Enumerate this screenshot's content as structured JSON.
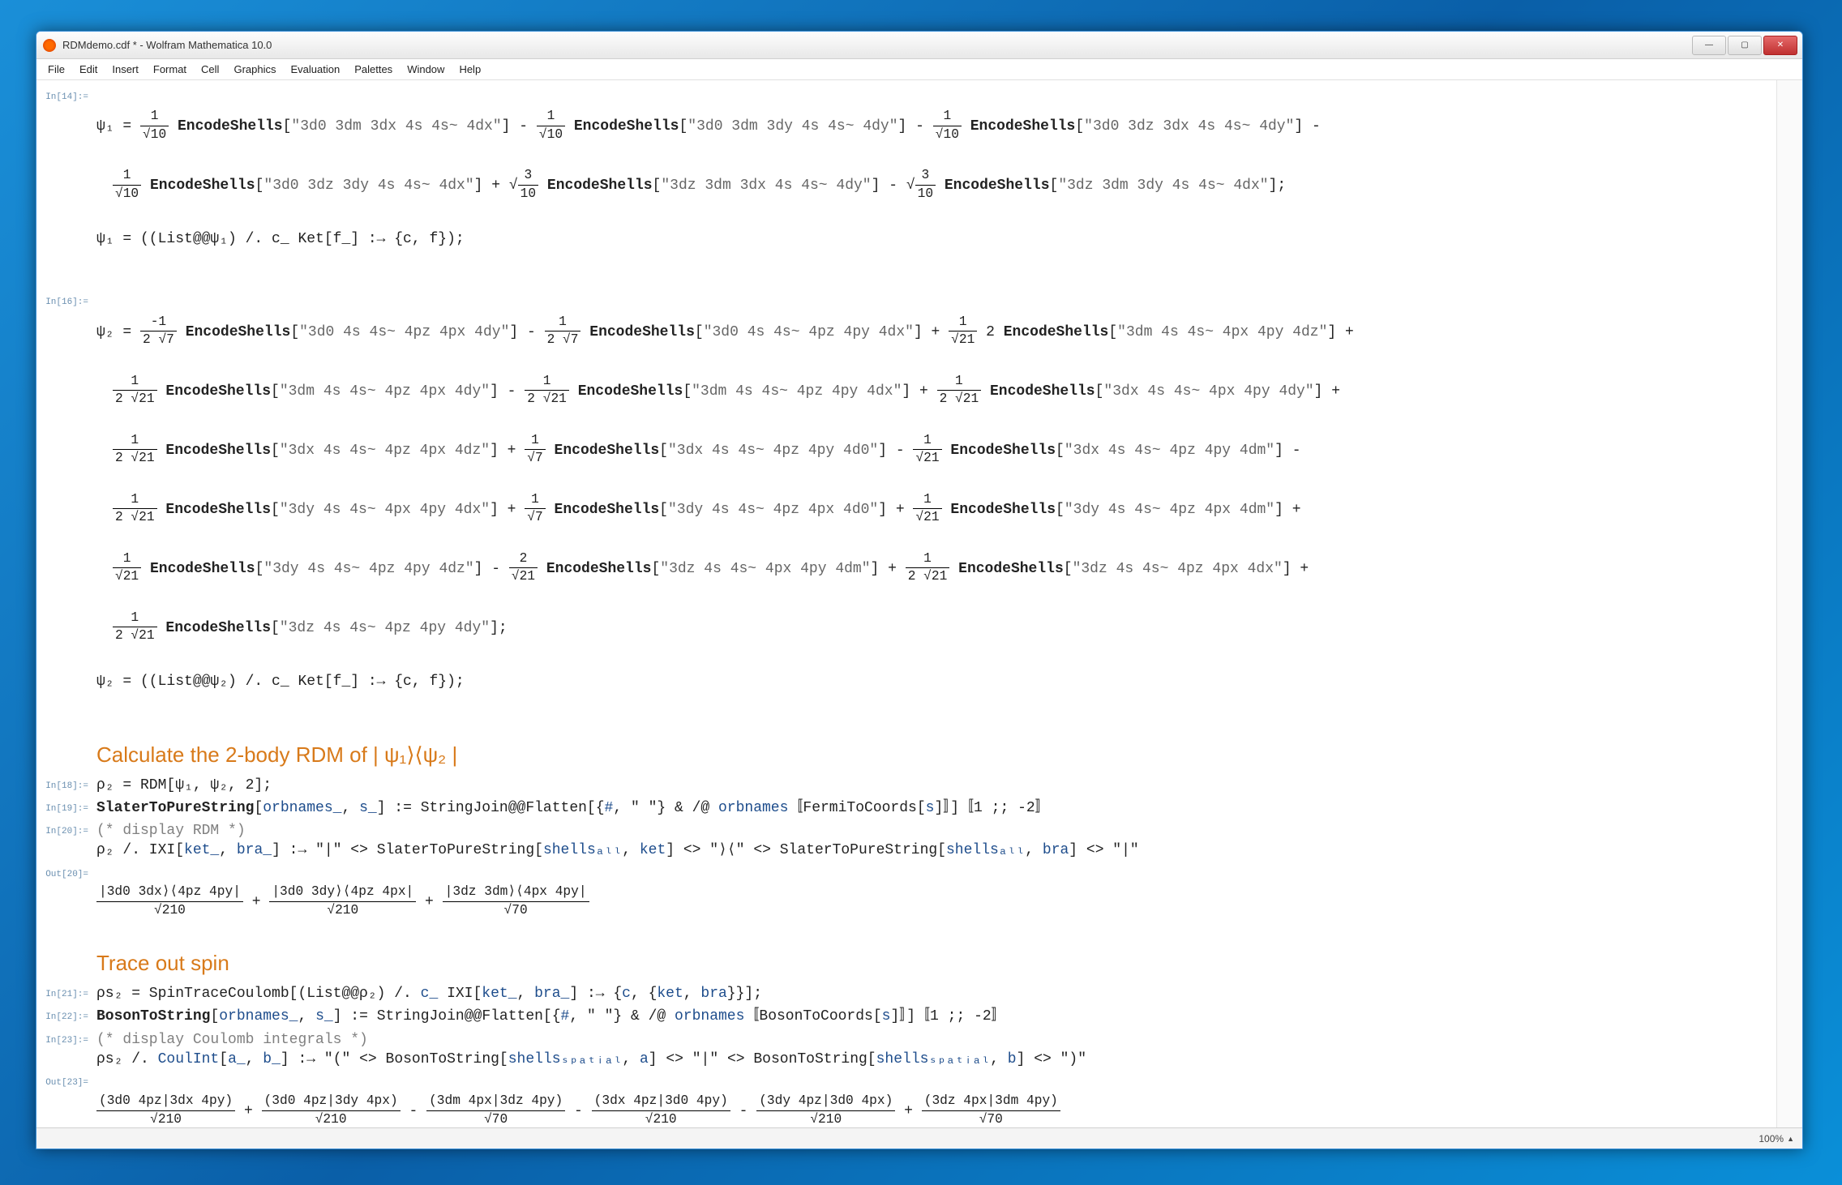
{
  "window": {
    "title": "RDMdemo.cdf * - Wolfram Mathematica 10.0"
  },
  "menu": {
    "file": "File",
    "edit": "Edit",
    "insert": "Insert",
    "format": "Format",
    "cell": "Cell",
    "graphics": "Graphics",
    "evaluation": "Evaluation",
    "palettes": "Palettes",
    "window": "Window",
    "help": "Help"
  },
  "labels": {
    "in14": "In[14]:=",
    "in16": "In[16]:=",
    "in18": "In[18]:=",
    "in19": "In[19]:=",
    "in20": "In[20]:=",
    "out20": "Out[20]=",
    "in21": "In[21]:=",
    "in22": "In[22]:=",
    "in23": "In[23]:=",
    "out23": "Out[23]="
  },
  "sections": {
    "rdm": "Calculate the 2-body RDM of  | ψ₁⟩⟨ψ₂ |",
    "trace": "Trace out spin"
  },
  "code": {
    "psi1_rule": "ψ₁ = ((List@@ψ₁) /. c_ Ket[f_] :→ {c, f});",
    "psi2_rule": "ψ₂ = ((List@@ψ₂) /. c_ Ket[f_] :→ {c, f});",
    "rho2": "ρ₂ = RDM[ψ₁, ψ₂, 2];",
    "slater": "SlaterToPureString[orbnames_, s_] := StringJoin@@Flatten[{#, \" \"} & /@ orbnames〚FermiToCoords[s]〛]〚1 ;; -2〛",
    "display_rdm": "(* display RDM *)",
    "rho2_disp": "ρ₂ /. IXI[ket_, bra_] :→ \"|\" <> SlaterToPureString[shellsₐₗₗ, ket] <> \"⟩⟨\" <> SlaterToPureString[shellsₐₗₗ, bra] <> \"|\"",
    "rhos2": "ρs₂ = SpinTraceCoulomb[(List@@ρ₂) /. c_ IXI[ket_, bra_] :→ {c, {ket, bra}}];",
    "boson": "BosonToString[orbnames_, s_] := StringJoin@@Flatten[{#, \" \"} & /@ orbnames〚BosonToCoords[s]〛]〚1 ;; -2〛",
    "display_coul": "(* display Coulomb integrals *)",
    "rhos2_disp": "ρs₂ /. CoulInt[a_, b_] :→ \"(\" <> BosonToString[shellsₛₚₐₜᵢₐₗ, a] <> \"|\" <> BosonToString[shellsₛₚₐₜᵢₐₗ, b] <> \")\""
  },
  "psi1_terms": [
    {
      "coef": "1/√10",
      "shells": "3d0 3dm 3dx 4s 4s~ 4dx",
      "sign": "-"
    },
    {
      "coef": "1/√10",
      "shells": "3d0 3dm 3dy 4s 4s~ 4dy",
      "sign": "-"
    },
    {
      "coef": "1/√10",
      "shells": "3d0 3dz 3dx 4s 4s~ 4dy",
      "sign": "-"
    },
    {
      "coef": "1/√10",
      "shells": "3d0 3dz 3dy 4s 4s~ 4dx",
      "sign": "+"
    },
    {
      "coef": "√(3/10)",
      "shells": "3dz 3dm 3dx 4s 4s~ 4dy",
      "sign": "-"
    },
    {
      "coef": "√(3/10)",
      "shells": "3dz 3dm 3dy 4s 4s~ 4dx",
      "sign": ""
    }
  ],
  "psi2_terms": [
    {
      "coef": "-1/(2√7)",
      "shells": "3d0 4s 4s~ 4pz 4px 4dy",
      "sign": "-"
    },
    {
      "coef": "1/(2√7)",
      "shells": "3d0 4s 4s~ 4pz 4py 4dx",
      "sign": "+"
    },
    {
      "coef": "1/√21",
      "mult": "2",
      "shells": "3dm 4s 4s~ 4px 4py 4dz",
      "sign": "+"
    },
    {
      "coef": "1/(2√21)",
      "shells": "3dm 4s 4s~ 4pz 4px 4dy",
      "sign": "-"
    },
    {
      "coef": "1/(2√21)",
      "shells": "3dm 4s 4s~ 4pz 4py 4dx",
      "sign": "+"
    },
    {
      "coef": "1/(2√21)",
      "shells": "3dx 4s 4s~ 4px 4py 4dy",
      "sign": "+"
    },
    {
      "coef": "1/(2√21)",
      "shells": "3dx 4s 4s~ 4pz 4px 4dz",
      "sign": "+"
    },
    {
      "coef": "1/√7",
      "shells": "3dx 4s 4s~ 4pz 4py 4d0",
      "sign": "-"
    },
    {
      "coef": "1/√21",
      "shells": "3dx 4s 4s~ 4pz 4py 4dm",
      "sign": "-"
    },
    {
      "coef": "1/(2√21)",
      "shells": "3dy 4s 4s~ 4px 4py 4dx",
      "sign": "+"
    },
    {
      "coef": "1/√7",
      "shells": "3dy 4s 4s~ 4pz 4px 4d0",
      "sign": "+"
    },
    {
      "coef": "1/√21",
      "shells": "3dy 4s 4s~ 4pz 4px 4dm",
      "sign": "+"
    },
    {
      "coef": "1/√21",
      "shells": "3dy 4s 4s~ 4pz 4py 4dz",
      "sign": "-"
    },
    {
      "coef": "2/√21",
      "shells": "3dz 4s 4s~ 4px 4py 4dm",
      "sign": "+"
    },
    {
      "coef": "1/(2√21)",
      "shells": "3dz 4s 4s~ 4pz 4px 4dx",
      "sign": "+"
    },
    {
      "coef": "1/(2√21)",
      "shells": "3dz 4s 4s~ 4pz 4py 4dy",
      "sign": ""
    }
  ],
  "out20_terms": [
    {
      "num": "|3d0 3dx⟩⟨4pz 4py|",
      "den": "√210",
      "op": "+"
    },
    {
      "num": "|3d0 3dy⟩⟨4pz 4px|",
      "den": "√210",
      "op": "+"
    },
    {
      "num": "|3dz 3dm⟩⟨4px 4py|",
      "den": "√70",
      "op": ""
    }
  ],
  "out23_terms": [
    {
      "num": "(3d0 4pz|3dx 4py)",
      "den": "√210",
      "op": "+"
    },
    {
      "num": "(3d0 4pz|3dy 4px)",
      "den": "√210",
      "op": "-"
    },
    {
      "num": "(3dm 4px|3dz 4py)",
      "den": "√70",
      "op": "-"
    },
    {
      "num": "(3dx 4pz|3d0 4py)",
      "den": "√210",
      "op": "-"
    },
    {
      "num": "(3dy 4pz|3d0 4px)",
      "den": "√210",
      "op": "+"
    },
    {
      "num": "(3dz 4px|3dm 4py)",
      "den": "√70",
      "op": ""
    }
  ],
  "status": {
    "zoom": "100%"
  }
}
